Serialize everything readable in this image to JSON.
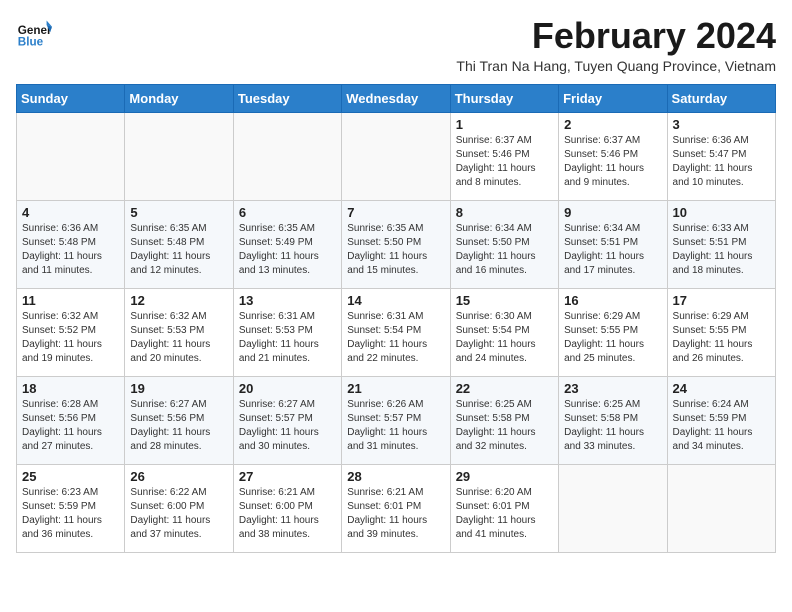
{
  "header": {
    "logo_line1": "General",
    "logo_line2": "Blue",
    "title": "February 2024",
    "subtitle": "Thi Tran Na Hang, Tuyen Quang Province, Vietnam"
  },
  "columns": [
    "Sunday",
    "Monday",
    "Tuesday",
    "Wednesday",
    "Thursday",
    "Friday",
    "Saturday"
  ],
  "weeks": [
    [
      {
        "day": "",
        "info": ""
      },
      {
        "day": "",
        "info": ""
      },
      {
        "day": "",
        "info": ""
      },
      {
        "day": "",
        "info": ""
      },
      {
        "day": "1",
        "info": "Sunrise: 6:37 AM\nSunset: 5:46 PM\nDaylight: 11 hours\nand 8 minutes."
      },
      {
        "day": "2",
        "info": "Sunrise: 6:37 AM\nSunset: 5:46 PM\nDaylight: 11 hours\nand 9 minutes."
      },
      {
        "day": "3",
        "info": "Sunrise: 6:36 AM\nSunset: 5:47 PM\nDaylight: 11 hours\nand 10 minutes."
      }
    ],
    [
      {
        "day": "4",
        "info": "Sunrise: 6:36 AM\nSunset: 5:48 PM\nDaylight: 11 hours\nand 11 minutes."
      },
      {
        "day": "5",
        "info": "Sunrise: 6:35 AM\nSunset: 5:48 PM\nDaylight: 11 hours\nand 12 minutes."
      },
      {
        "day": "6",
        "info": "Sunrise: 6:35 AM\nSunset: 5:49 PM\nDaylight: 11 hours\nand 13 minutes."
      },
      {
        "day": "7",
        "info": "Sunrise: 6:35 AM\nSunset: 5:50 PM\nDaylight: 11 hours\nand 15 minutes."
      },
      {
        "day": "8",
        "info": "Sunrise: 6:34 AM\nSunset: 5:50 PM\nDaylight: 11 hours\nand 16 minutes."
      },
      {
        "day": "9",
        "info": "Sunrise: 6:34 AM\nSunset: 5:51 PM\nDaylight: 11 hours\nand 17 minutes."
      },
      {
        "day": "10",
        "info": "Sunrise: 6:33 AM\nSunset: 5:51 PM\nDaylight: 11 hours\nand 18 minutes."
      }
    ],
    [
      {
        "day": "11",
        "info": "Sunrise: 6:32 AM\nSunset: 5:52 PM\nDaylight: 11 hours\nand 19 minutes."
      },
      {
        "day": "12",
        "info": "Sunrise: 6:32 AM\nSunset: 5:53 PM\nDaylight: 11 hours\nand 20 minutes."
      },
      {
        "day": "13",
        "info": "Sunrise: 6:31 AM\nSunset: 5:53 PM\nDaylight: 11 hours\nand 21 minutes."
      },
      {
        "day": "14",
        "info": "Sunrise: 6:31 AM\nSunset: 5:54 PM\nDaylight: 11 hours\nand 22 minutes."
      },
      {
        "day": "15",
        "info": "Sunrise: 6:30 AM\nSunset: 5:54 PM\nDaylight: 11 hours\nand 24 minutes."
      },
      {
        "day": "16",
        "info": "Sunrise: 6:29 AM\nSunset: 5:55 PM\nDaylight: 11 hours\nand 25 minutes."
      },
      {
        "day": "17",
        "info": "Sunrise: 6:29 AM\nSunset: 5:55 PM\nDaylight: 11 hours\nand 26 minutes."
      }
    ],
    [
      {
        "day": "18",
        "info": "Sunrise: 6:28 AM\nSunset: 5:56 PM\nDaylight: 11 hours\nand 27 minutes."
      },
      {
        "day": "19",
        "info": "Sunrise: 6:27 AM\nSunset: 5:56 PM\nDaylight: 11 hours\nand 28 minutes."
      },
      {
        "day": "20",
        "info": "Sunrise: 6:27 AM\nSunset: 5:57 PM\nDaylight: 11 hours\nand 30 minutes."
      },
      {
        "day": "21",
        "info": "Sunrise: 6:26 AM\nSunset: 5:57 PM\nDaylight: 11 hours\nand 31 minutes."
      },
      {
        "day": "22",
        "info": "Sunrise: 6:25 AM\nSunset: 5:58 PM\nDaylight: 11 hours\nand 32 minutes."
      },
      {
        "day": "23",
        "info": "Sunrise: 6:25 AM\nSunset: 5:58 PM\nDaylight: 11 hours\nand 33 minutes."
      },
      {
        "day": "24",
        "info": "Sunrise: 6:24 AM\nSunset: 5:59 PM\nDaylight: 11 hours\nand 34 minutes."
      }
    ],
    [
      {
        "day": "25",
        "info": "Sunrise: 6:23 AM\nSunset: 5:59 PM\nDaylight: 11 hours\nand 36 minutes."
      },
      {
        "day": "26",
        "info": "Sunrise: 6:22 AM\nSunset: 6:00 PM\nDaylight: 11 hours\nand 37 minutes."
      },
      {
        "day": "27",
        "info": "Sunrise: 6:21 AM\nSunset: 6:00 PM\nDaylight: 11 hours\nand 38 minutes."
      },
      {
        "day": "28",
        "info": "Sunrise: 6:21 AM\nSunset: 6:01 PM\nDaylight: 11 hours\nand 39 minutes."
      },
      {
        "day": "29",
        "info": "Sunrise: 6:20 AM\nSunset: 6:01 PM\nDaylight: 11 hours\nand 41 minutes."
      },
      {
        "day": "",
        "info": ""
      },
      {
        "day": "",
        "info": ""
      }
    ]
  ]
}
